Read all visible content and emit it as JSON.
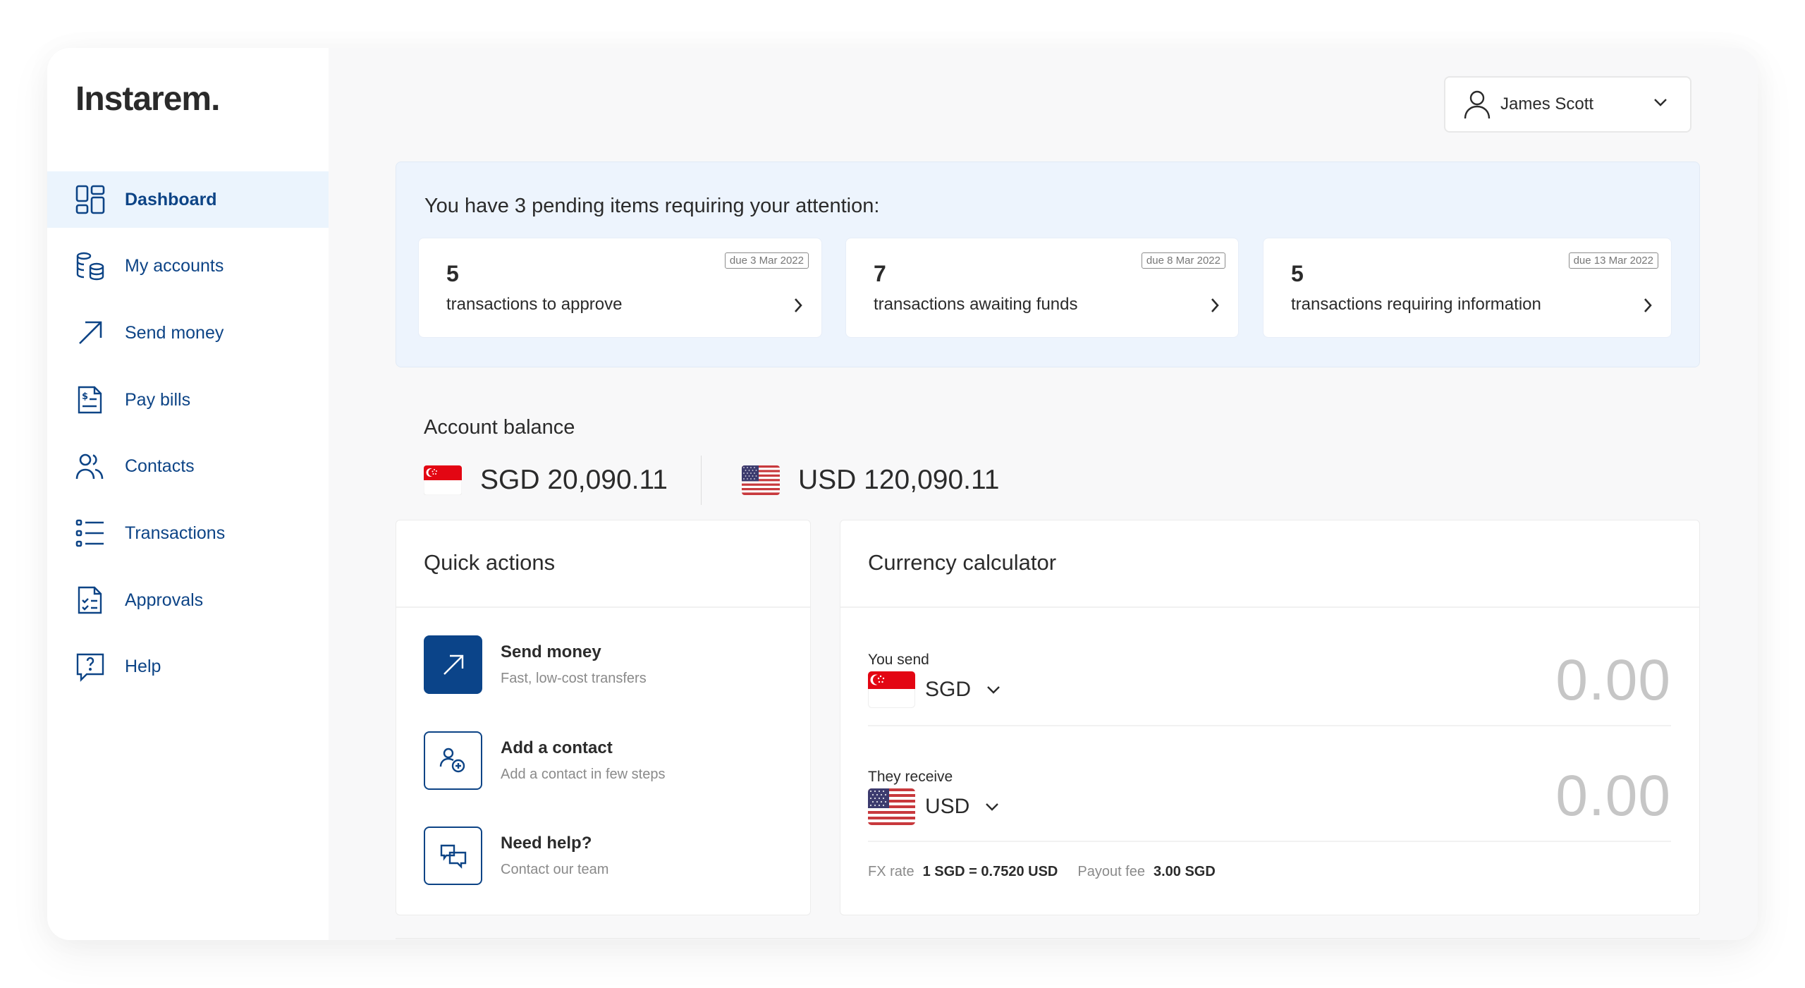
{
  "app": {
    "logo": "Instarem.",
    "accent_color": "#0b4489",
    "active_bg_color": "#ebf4fd"
  },
  "sidebar": {
    "items": [
      {
        "label": "Dashboard",
        "icon": "dashboard-grid-icon",
        "active": true
      },
      {
        "label": "My accounts",
        "icon": "coins-stack-icon",
        "active": false
      },
      {
        "label": "Send money",
        "icon": "arrow-up-right-icon",
        "active": false
      },
      {
        "label": "Pay bills",
        "icon": "bill-document-icon",
        "active": false
      },
      {
        "label": "Contacts",
        "icon": "people-icon",
        "active": false
      },
      {
        "label": "Transactions",
        "icon": "list-icon",
        "active": false
      },
      {
        "label": "Approvals",
        "icon": "checklist-document-icon",
        "active": false
      },
      {
        "label": "Help",
        "icon": "help-chat-icon",
        "active": false
      }
    ]
  },
  "header": {
    "user_name": "James Scott"
  },
  "pending": {
    "title": "You have 3 pending items requiring your attention:",
    "items": [
      {
        "count": "5",
        "description": "transactions to approve",
        "due": "due 3 Mar 2022"
      },
      {
        "count": "7",
        "description": "transactions awaiting funds",
        "due": "due 8 Mar 2022"
      },
      {
        "count": "5",
        "description": "transactions requiring information",
        "due": "due 13 Mar 2022"
      }
    ]
  },
  "balance": {
    "title": "Account balance",
    "accounts": [
      {
        "currency": "SGD",
        "flag": "singapore-flag",
        "amount": "SGD 20,090.11"
      },
      {
        "currency": "USD",
        "flag": "us-flag",
        "amount": "USD 120,090.11"
      }
    ]
  },
  "quick_actions": {
    "title": "Quick actions",
    "items": [
      {
        "title": "Send money",
        "subtitle": "Fast, low-cost transfers",
        "icon": "arrow-up-right-icon"
      },
      {
        "title": "Add a contact",
        "subtitle": "Add a contact in few steps",
        "icon": "add-contact-icon"
      },
      {
        "title": "Need help?",
        "subtitle": "Contact our team",
        "icon": "chat-bubbles-icon"
      }
    ]
  },
  "calculator": {
    "title": "Currency calculator",
    "send_label": "You send",
    "send_currency": "SGD",
    "send_amount": "0.00",
    "receive_label": "They receive",
    "receive_currency": "USD",
    "receive_amount": "0.00",
    "fx_rate_label": "FX rate",
    "fx_rate_value": "1 SGD = 0.7520 USD",
    "payout_fee_label": "Payout fee",
    "payout_fee_value": "3.00 SGD"
  }
}
